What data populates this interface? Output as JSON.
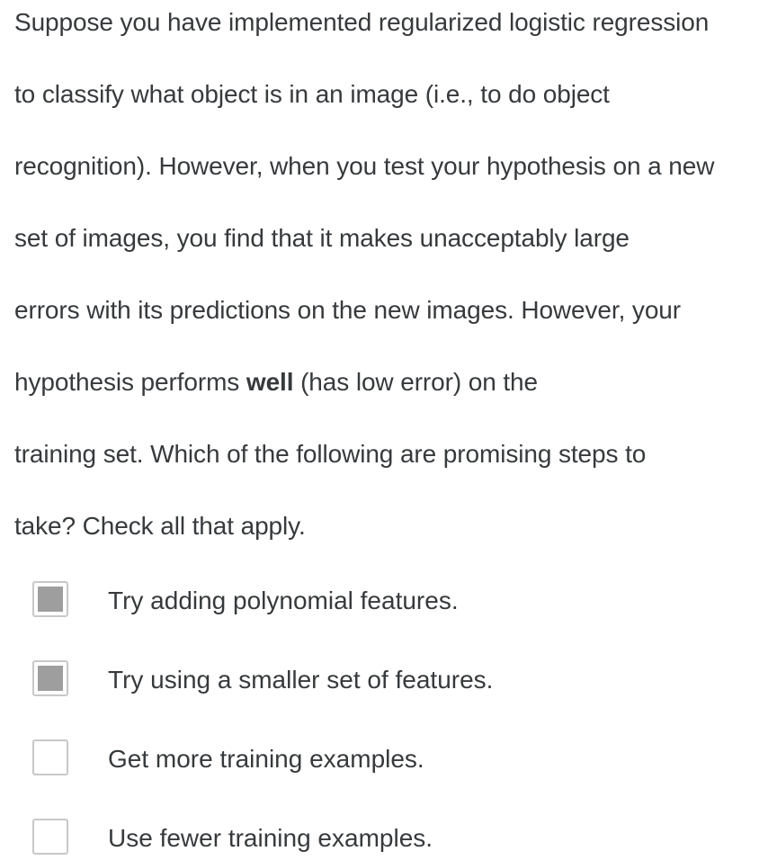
{
  "question": {
    "lines": [
      "Suppose you have implemented regularized logistic regression",
      "to classify what object is in an image (i.e., to do object",
      "recognition). However, when you test your hypothesis on a new",
      "set of images, you find that it makes unacceptably large",
      "errors with its predictions on the new images. However, your"
    ],
    "line6_pre": "hypothesis performs ",
    "line6_bold": "well",
    "line6_post": " (has low error) on the",
    "line7": "training set. Which of the following are promising steps to",
    "line8": "take? Check all that apply."
  },
  "options": [
    {
      "label": "Try adding polynomial features.",
      "checked": true
    },
    {
      "label": "Try using a smaller set of features.",
      "checked": true
    },
    {
      "label": "Get more training examples.",
      "checked": false
    },
    {
      "label": "Use fewer training examples.",
      "checked": false
    }
  ]
}
